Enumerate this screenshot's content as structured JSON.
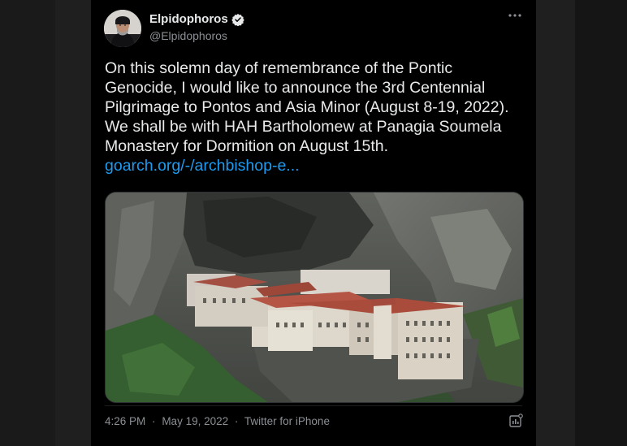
{
  "tweet": {
    "author_name": "Elpidophoros",
    "author_handle": "@Elpidophoros",
    "text_body": "On this solemn day of remembrance of the Pontic Genocide, I would like to announce the 3rd Centennial Pilgrimage to Pontos and Asia Minor (August 8-19, 2022). We shall be with HAH Bartholomew at Panagia Soumela Monastery for Dormition on August 15th.",
    "link_text": "goarch.org/-/archbishop-e...",
    "time": "4:26 PM",
    "date": "May 19, 2022",
    "separator": "·",
    "source": "Twitter for iPhone"
  },
  "icons": {
    "verified": "verified-badge-icon",
    "more": "more-options-icon",
    "analytics": "analytics-icon"
  },
  "colors": {
    "background": "#000000",
    "text": "#e7e9ea",
    "secondary_text": "#8b8f94",
    "link": "#1d9bf0"
  }
}
